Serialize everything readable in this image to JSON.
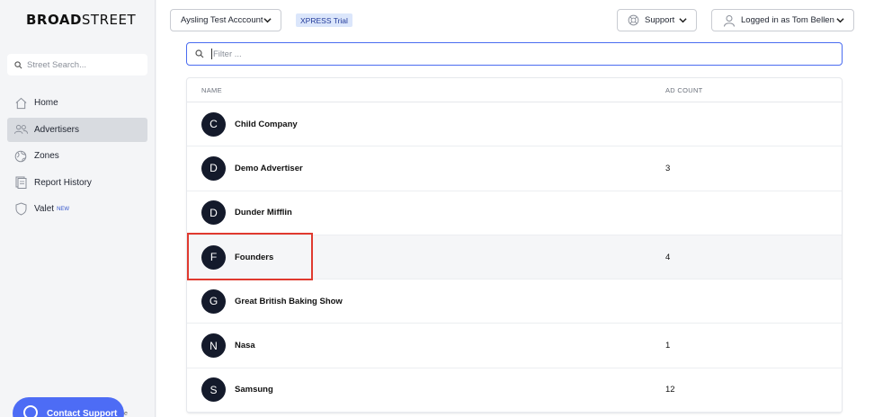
{
  "brand": {
    "bold": "BROAD",
    "light": "STREET"
  },
  "sidebar": {
    "search_placeholder": "Street Search...",
    "items": [
      {
        "label": "Home",
        "icon": "home-icon",
        "active": false
      },
      {
        "label": "Advertisers",
        "icon": "users-icon",
        "active": true
      },
      {
        "label": "Zones",
        "icon": "globe-icon",
        "active": false
      },
      {
        "label": "Report History",
        "icon": "report-icon",
        "active": false
      },
      {
        "label": "Valet",
        "badge": "NEW",
        "icon": "shield-icon",
        "active": false
      }
    ],
    "contact_label": "Contact Support",
    "contact_tail": "e"
  },
  "header": {
    "account_label": "Aysling Test Acccount",
    "trial_badge": "XPRESS Trial",
    "support_label": "Support",
    "user_label": "Logged in as Tom Bellen"
  },
  "filter": {
    "placeholder": "Filter ..."
  },
  "table": {
    "columns": {
      "name": "NAME",
      "ad_count": "AD COUNT"
    },
    "rows": [
      {
        "initial": "C",
        "name": "Child Company",
        "count": ""
      },
      {
        "initial": "D",
        "name": "Demo Advertiser",
        "count": "3"
      },
      {
        "initial": "D",
        "name": "Dunder Mifflin",
        "count": ""
      },
      {
        "initial": "F",
        "name": "Founders",
        "count": "4"
      },
      {
        "initial": "G",
        "name": "Great British Baking Show",
        "count": ""
      },
      {
        "initial": "N",
        "name": "Nasa",
        "count": "1"
      },
      {
        "initial": "S",
        "name": "Samsung",
        "count": "12"
      }
    ]
  },
  "colors": {
    "accent": "#4a6cf0",
    "avatar": "#141a2b",
    "highlight": "#e03a2f"
  }
}
